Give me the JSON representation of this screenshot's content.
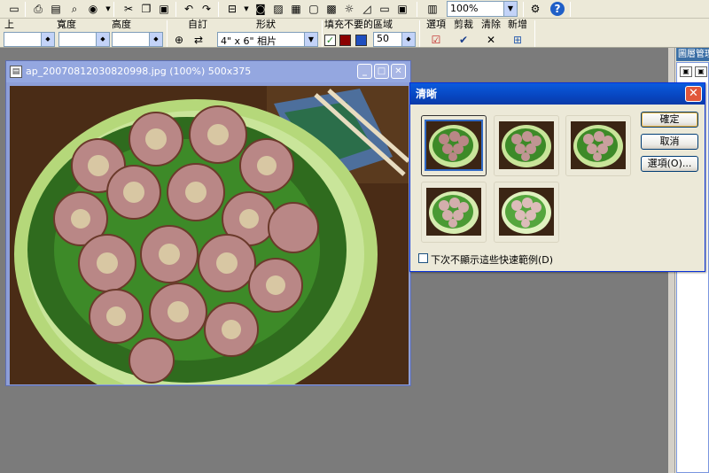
{
  "toolbar": {
    "zoom_value": "100%",
    "labels": {
      "top": "上",
      "width": "寬度",
      "height": "高度",
      "custom": "自訂",
      "shape": "形狀",
      "fill": "填充不要的區域",
      "options": "選項",
      "crop": "剪裁",
      "clear": "清除",
      "new": "新增"
    },
    "shape_value": "4\" x 6\" 相片",
    "fill_value": "50"
  },
  "right_panel": {
    "title": "圖層管理"
  },
  "image_window": {
    "title": "ap_20070812030820998.jpg (100%) 500x375"
  },
  "dialog": {
    "title": "清晰",
    "ok_label": "確定",
    "cancel_label": "取消",
    "options_label": "選項(O)...",
    "dont_show_label": "下次不顯示這些快速範例(D)"
  },
  "colors": {
    "dialog_title": "#0746c0",
    "accent": "#316ac5"
  },
  "icons": [
    "save-icon",
    "print-icon",
    "preview-icon",
    "zoom-icon",
    "scan-icon",
    "cut-icon",
    "copy-icon",
    "paste-icon",
    "undo-icon",
    "redo-icon",
    "help-icon"
  ]
}
